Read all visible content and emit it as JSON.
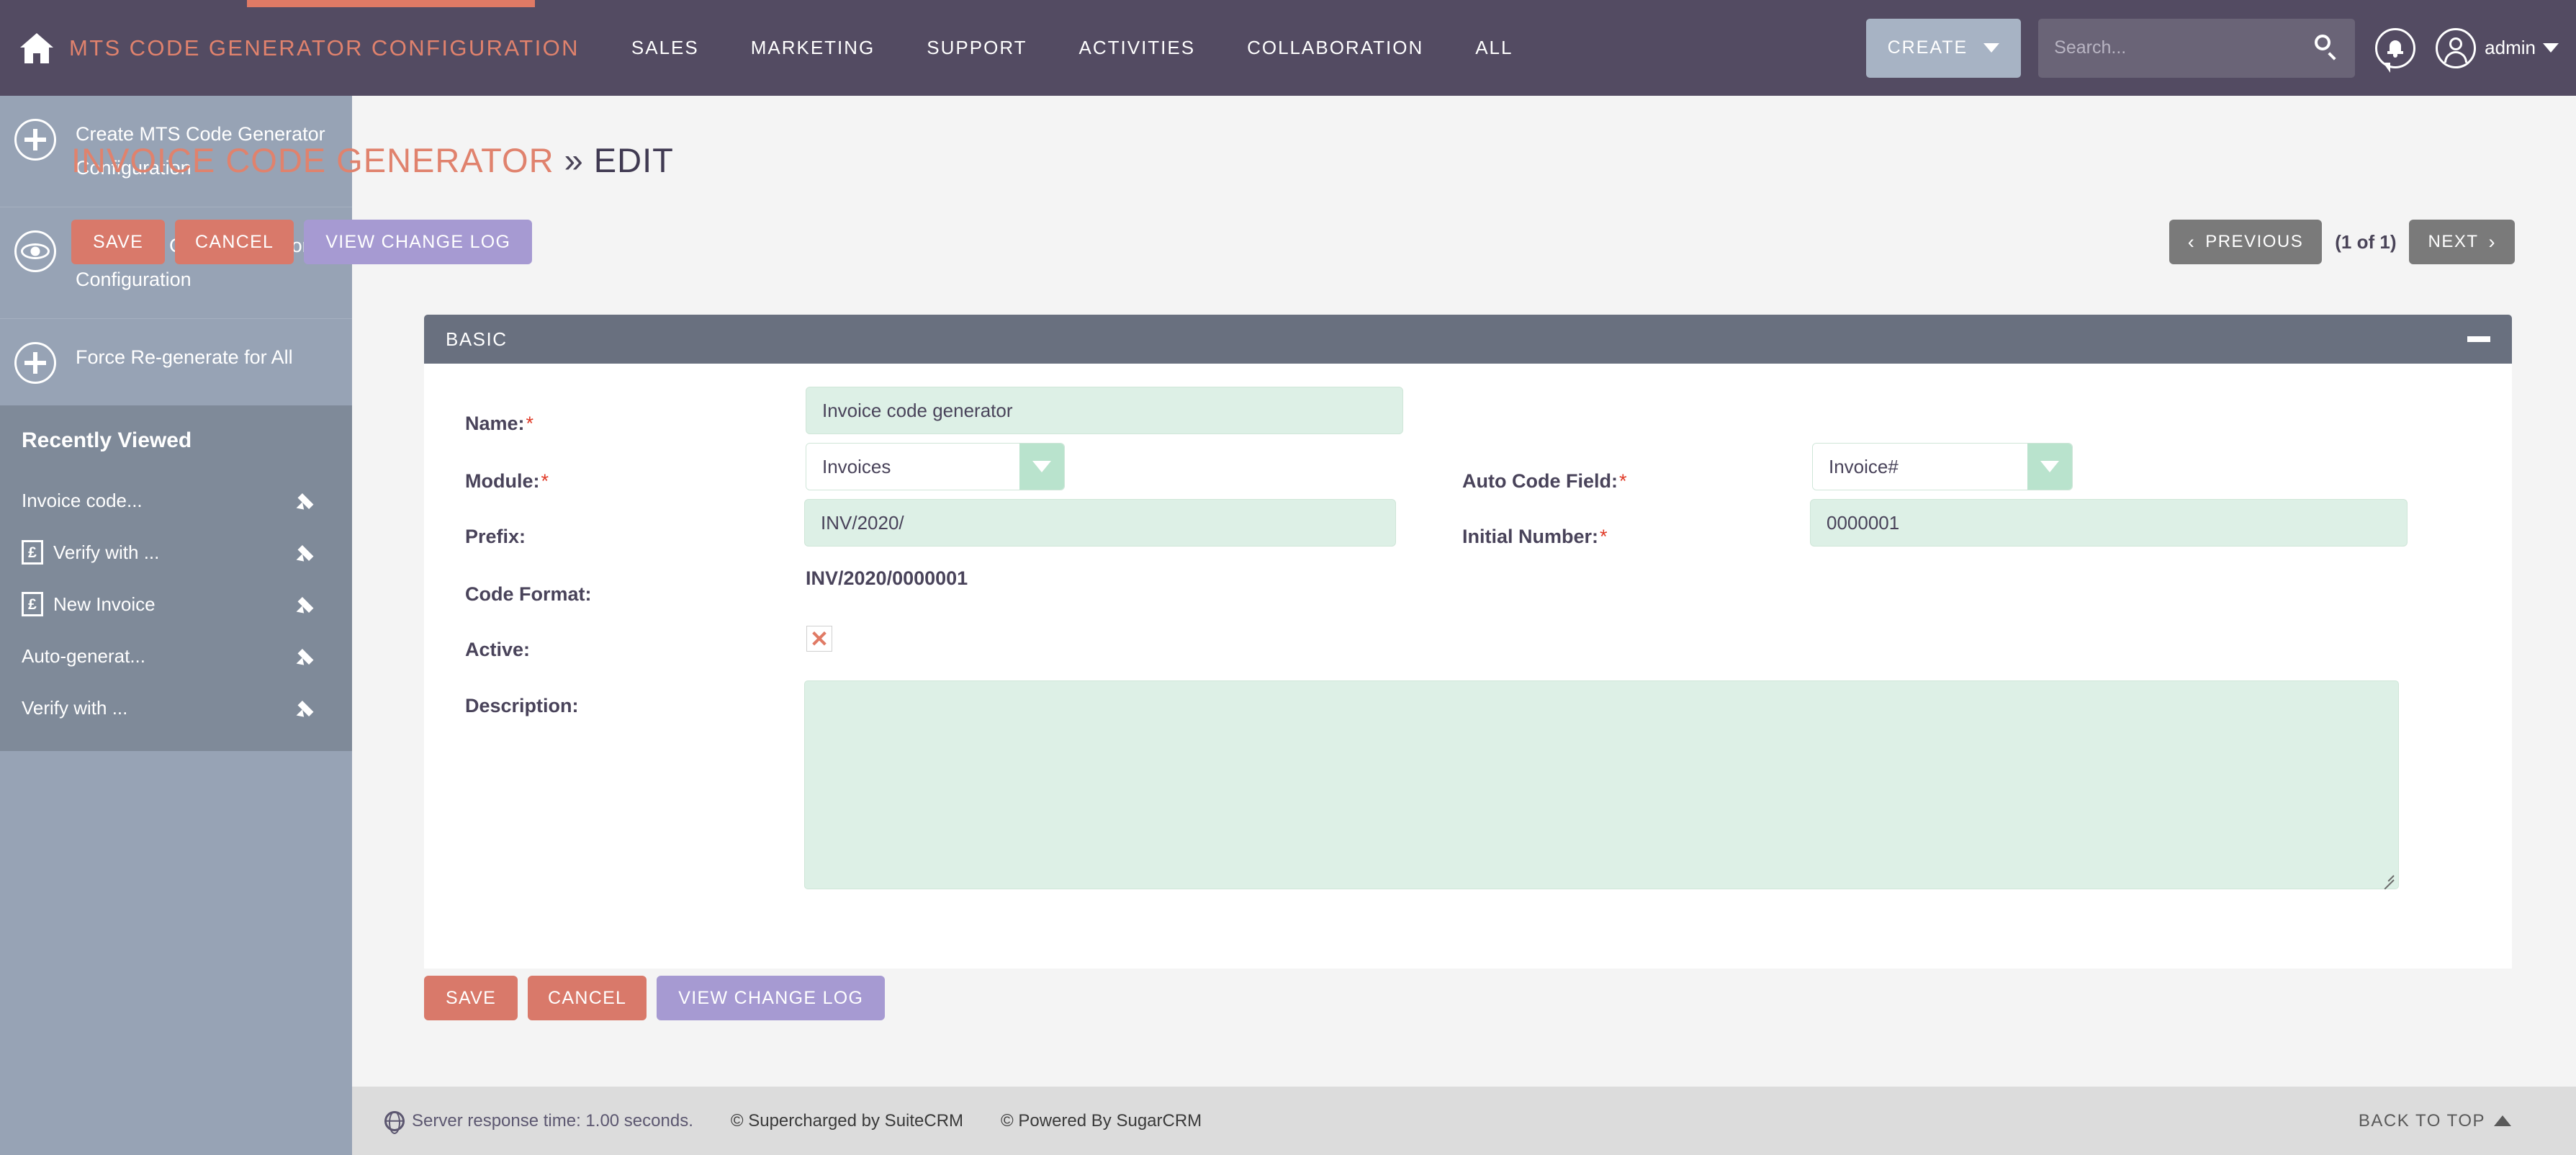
{
  "topbar": {
    "module_title": "MTS CODE GENERATOR CONFIGURATION",
    "nav_items": [
      {
        "label": "SALES"
      },
      {
        "label": "MARKETING"
      },
      {
        "label": "SUPPORT"
      },
      {
        "label": "ACTIVITIES"
      },
      {
        "label": "COLLABORATION"
      },
      {
        "label": "ALL"
      }
    ],
    "create_label": "CREATE",
    "search_placeholder": "Search...",
    "search_value": "",
    "admin_label": "admin",
    "accent_color": "#e07a65",
    "bar_color": "#534b62"
  },
  "sidebar": {
    "actions": [
      {
        "label": "Create MTS Code Generator Configuration",
        "icon": "plus-circle-icon"
      },
      {
        "label": "View MTS Code Generator Configuration",
        "icon": "eye-circle-icon"
      },
      {
        "label": "Force Re-generate for All",
        "icon": "plus-circle-icon"
      }
    ],
    "recent_header": "Recently Viewed",
    "recent_items": [
      {
        "label": "Invoice code...",
        "has_icon": false,
        "icon_glyph": ""
      },
      {
        "label": "Verify with ...",
        "has_icon": true,
        "icon_glyph": "£"
      },
      {
        "label": "New Invoice",
        "has_icon": true,
        "icon_glyph": "£"
      },
      {
        "label": "Auto-generat...",
        "has_icon": false,
        "icon_glyph": ""
      },
      {
        "label": "Verify with ...",
        "has_icon": false,
        "icon_glyph": ""
      }
    ]
  },
  "page": {
    "title_module": "INVOICE CODE GENERATOR",
    "title_sep": "»",
    "title_action": "EDIT"
  },
  "actions": {
    "save_label": "SAVE",
    "cancel_label": "CANCEL",
    "changelog_label": "VIEW CHANGE LOG"
  },
  "pagination": {
    "previous_label": "PREVIOUS",
    "count_label": "(1 of 1)",
    "next_label": "NEXT"
  },
  "panel": {
    "title": "BASIC",
    "fields": {
      "name": {
        "label": "Name:",
        "required": true,
        "value": "Invoice code generator"
      },
      "module": {
        "label": "Module:",
        "required": true,
        "value": "Invoices"
      },
      "prefix": {
        "label": "Prefix:",
        "required": false,
        "value": "INV/2020/"
      },
      "code_format": {
        "label": "Code Format:",
        "required": false,
        "value": "INV/2020/0000001"
      },
      "active": {
        "label": "Active:",
        "required": false,
        "checked": true,
        "mark": "✕"
      },
      "description": {
        "label": "Description:",
        "required": false,
        "value": ""
      },
      "auto_code_field": {
        "label": "Auto Code Field:",
        "required": true,
        "value": "Invoice#"
      },
      "initial_number": {
        "label": "Initial Number:",
        "required": true,
        "value": "0000001"
      }
    }
  },
  "footer": {
    "server_response": "Server response time: 1.00 seconds.",
    "copyright_suite": "© Supercharged by SuiteCRM",
    "copyright_sugar": "© Powered By SugarCRM",
    "back_to_top": "BACK TO TOP"
  }
}
